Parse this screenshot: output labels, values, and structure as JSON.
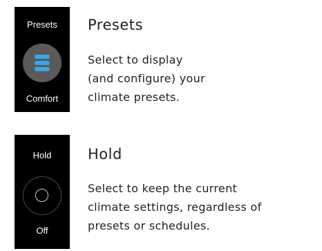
{
  "presets": {
    "panel_title": "Presets",
    "panel_value": "Comfort",
    "heading": "Presets",
    "description_lines": [
      "Select to display",
      "(and configure) your",
      "climate presets."
    ],
    "icon": "presets-list-icon",
    "icon_color": "#3aa8e8"
  },
  "hold": {
    "panel_title": "Hold",
    "panel_value": "Off",
    "heading": "Hold",
    "description_lines": [
      "Select to keep the current",
      "climate settings, regardless of",
      "presets or schedules."
    ],
    "icon": "hold-ring-icon"
  }
}
